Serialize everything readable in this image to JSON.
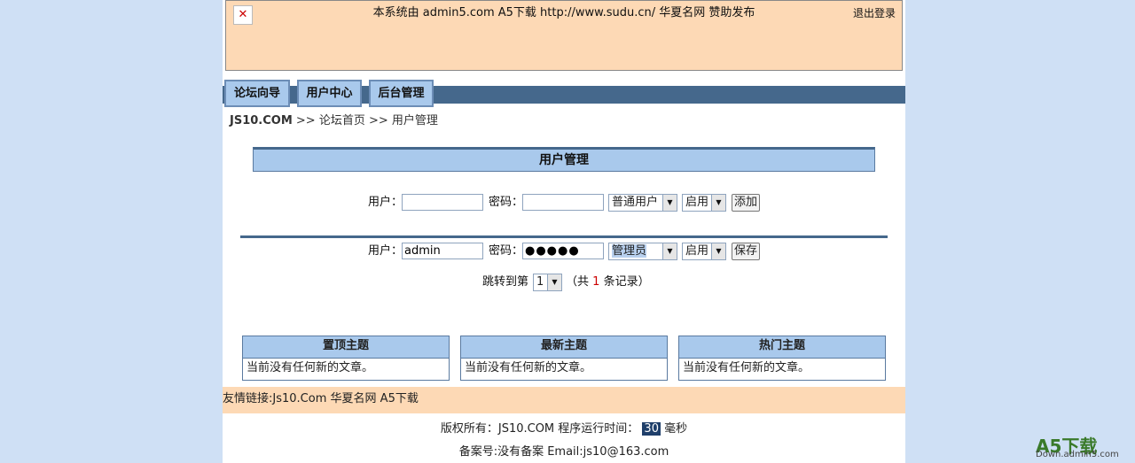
{
  "header": {
    "notice": "本系统由 admin5.com A5下载 http://www.sudu.cn/ 华夏名网 赞助发布",
    "logout": "退出登录",
    "broken_image_glyph": "✕"
  },
  "nav": {
    "tabs": [
      "论坛向导",
      "用户中心",
      "后台管理"
    ],
    "bar_color": "#45688c"
  },
  "breadcrumb": {
    "site": "JS10.COM",
    "trail": ">> 论坛首页 >> 用户管理"
  },
  "panel": {
    "title": "用户管理"
  },
  "add_form": {
    "user_label": "用户：",
    "user_value": "",
    "password_label": "密码：",
    "password_value": "",
    "role": "普通用户",
    "status": "启用",
    "submit": "添加"
  },
  "edit_form": {
    "user_label": "用户：",
    "user_value": "admin",
    "password_label": "密码：",
    "password_value": "●●●●●",
    "role": "管理员",
    "status": "启用",
    "submit": "保存"
  },
  "pagination": {
    "jump_label": "跳转到第",
    "page": "1",
    "total_prefix": "（共",
    "total": "1",
    "total_suffix": "条记录）"
  },
  "topic_boxes": [
    {
      "title": "置顶主题",
      "body": "当前没有任何新的文章。"
    },
    {
      "title": "最新主题",
      "body": "当前没有任何新的文章。"
    },
    {
      "title": "热门主题",
      "body": "当前没有任何新的文章。"
    }
  ],
  "links": {
    "label": "友情链接:",
    "items": [
      "Js10.Com",
      "华夏名网",
      "A5下载"
    ]
  },
  "footer": {
    "copyright": "版权所有：JS10.COM 程序运行时间：",
    "runtime": "30",
    "unit": "毫秒",
    "icp": "备案号:没有备案 Email:js10@163.com"
  },
  "watermark": {
    "brand": "A5下载",
    "url": "Down.admin5.com"
  }
}
